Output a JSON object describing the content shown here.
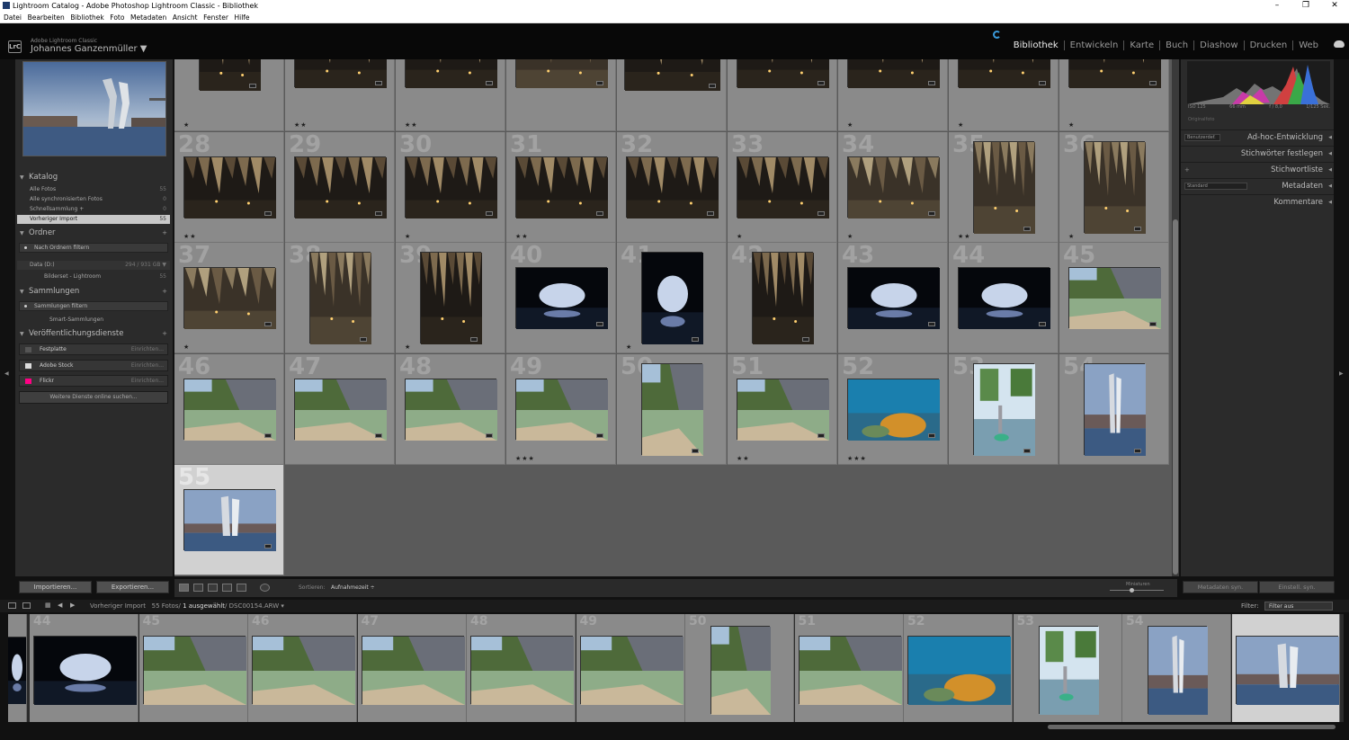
{
  "window": {
    "title": "Lightroom Catalog - Adobe Photoshop Lightroom Classic - Bibliothek",
    "controls": [
      "–",
      "❐",
      "✕"
    ]
  },
  "menu": [
    "Datei",
    "Bearbeiten",
    "Bibliothek",
    "Foto",
    "Metadaten",
    "Ansicht",
    "Fenster",
    "Hilfe"
  ],
  "identity": {
    "badge": "LrC",
    "product": "Adobe Lightroom Classic",
    "user": "Johannes Ganzenmüller ▼"
  },
  "modules": [
    {
      "label": "Bibliothek",
      "active": true
    },
    {
      "label": "Entwickeln",
      "active": false
    },
    {
      "label": "Karte",
      "active": false
    },
    {
      "label": "Buch",
      "active": false
    },
    {
      "label": "Diashow",
      "active": false
    },
    {
      "label": "Drucken",
      "active": false
    },
    {
      "label": "Web",
      "active": false
    }
  ],
  "left_panel": {
    "katalog": {
      "title": "Katalog",
      "items": [
        {
          "label": "Alle Fotos",
          "count": "55"
        },
        {
          "label": "Alle synchronisierten Fotos",
          "count": "0"
        },
        {
          "label": "Schnellsammlung +",
          "count": "0"
        },
        {
          "label": "Vorheriger Import",
          "count": "55",
          "selected": true
        }
      ]
    },
    "ordner": {
      "title": "Ordner",
      "filter": "Nach Ordnern filtern",
      "volume": {
        "label": "Data (D:)",
        "info": "294 / 931 GB ▼"
      },
      "folder": {
        "label": "Bilderset - Lightroom",
        "count": "55"
      }
    },
    "sammlungen": {
      "title": "Sammlungen",
      "filter": "Sammlungen filtern",
      "smart": "Smart-Sammlungen"
    },
    "dienste": {
      "title": "Veröffentlichungsdienste",
      "services": [
        {
          "label": "Festplatte",
          "setup": "Einrichten...",
          "color": "#555555"
        },
        {
          "label": "Adobe Stock",
          "setup": "Einrichten...",
          "color": "#1a1a1a"
        },
        {
          "label": "Flickr",
          "setup": "Einrichten...",
          "color": "#ff0084"
        }
      ],
      "more": "Weitere Dienste online suchen..."
    },
    "import_btn": "Importieren...",
    "export_btn": "Exportieren..."
  },
  "grid": {
    "cells": [
      {
        "num": "",
        "stars": "★",
        "kind": "cave",
        "shape": "portrait-s"
      },
      {
        "num": "",
        "stars": "★★",
        "kind": "cave",
        "shape": "land"
      },
      {
        "num": "",
        "stars": "★★",
        "kind": "cave",
        "shape": "land"
      },
      {
        "num": "",
        "stars": "",
        "kind": "cave-light",
        "shape": "land"
      },
      {
        "num": "",
        "stars": "",
        "kind": "cave",
        "shape": "land-t"
      },
      {
        "num": "",
        "stars": "",
        "kind": "cave",
        "shape": "land"
      },
      {
        "num": "",
        "stars": "★",
        "kind": "cave",
        "shape": "land"
      },
      {
        "num": "",
        "stars": "★",
        "kind": "cave",
        "shape": "land"
      },
      {
        "num": "",
        "stars": "★",
        "kind": "cave",
        "shape": "land"
      },
      {
        "num": "28",
        "stars": "★★",
        "kind": "cave",
        "shape": "land"
      },
      {
        "num": "29",
        "stars": "",
        "kind": "cave",
        "shape": "land"
      },
      {
        "num": "30",
        "stars": "★",
        "kind": "cave",
        "shape": "land"
      },
      {
        "num": "31",
        "stars": "★★",
        "kind": "cave",
        "shape": "land"
      },
      {
        "num": "32",
        "stars": "",
        "kind": "cave",
        "shape": "land"
      },
      {
        "num": "33",
        "stars": "★",
        "kind": "cave",
        "shape": "land"
      },
      {
        "num": "34",
        "stars": "★",
        "kind": "cave-light",
        "shape": "land"
      },
      {
        "num": "35",
        "stars": "★★",
        "kind": "cave-light",
        "shape": "portrait"
      },
      {
        "num": "36",
        "stars": "★",
        "kind": "cave-light",
        "shape": "portrait"
      },
      {
        "num": "37",
        "stars": "★",
        "kind": "cave-light",
        "shape": "land"
      },
      {
        "num": "38",
        "stars": "",
        "kind": "cave-light",
        "shape": "portrait"
      },
      {
        "num": "39",
        "stars": "★",
        "kind": "cave",
        "shape": "portrait"
      },
      {
        "num": "40",
        "stars": "",
        "kind": "arch",
        "shape": "land"
      },
      {
        "num": "41",
        "stars": "★",
        "kind": "arch",
        "shape": "portrait"
      },
      {
        "num": "42",
        "stars": "",
        "kind": "cave",
        "shape": "portrait"
      },
      {
        "num": "43",
        "stars": "",
        "kind": "arch",
        "shape": "land"
      },
      {
        "num": "44",
        "stars": "",
        "kind": "arch",
        "shape": "land"
      },
      {
        "num": "45",
        "stars": "",
        "kind": "river",
        "shape": "land"
      },
      {
        "num": "46",
        "stars": "",
        "kind": "river",
        "shape": "land"
      },
      {
        "num": "47",
        "stars": "",
        "kind": "river",
        "shape": "land"
      },
      {
        "num": "48",
        "stars": "",
        "kind": "river",
        "shape": "land"
      },
      {
        "num": "49",
        "stars": "★★★",
        "kind": "river",
        "shape": "land"
      },
      {
        "num": "50",
        "stars": "",
        "kind": "river",
        "shape": "portrait"
      },
      {
        "num": "51",
        "stars": "★★",
        "kind": "river",
        "shape": "land"
      },
      {
        "num": "52",
        "stars": "★★★",
        "kind": "reef",
        "shape": "land"
      },
      {
        "num": "53",
        "stars": "",
        "kind": "lake",
        "shape": "portrait"
      },
      {
        "num": "54",
        "stars": "",
        "kind": "statue",
        "shape": "portrait"
      },
      {
        "num": "55",
        "stars": "",
        "kind": "statue",
        "shape": "land",
        "selected": true
      }
    ]
  },
  "toolbar": {
    "sort_label": "Sortieren:",
    "sort_value": "Aufnahmezeit ÷",
    "thumb_label": "Miniaturen"
  },
  "right_panel": {
    "histogram": {
      "iso": "ISO 125",
      "focal": "66 mm",
      "aperture": "f / 8,0",
      "shutter": "1/125 Sek."
    },
    "original_photo": "Originalfoto",
    "sections": [
      {
        "label": "Ad-hoc-Entwicklung",
        "select": "Benutzerdef."
      },
      {
        "label": "Stichwörter festlegen",
        "select": ""
      },
      {
        "label": "Stichwortliste",
        "select": ""
      },
      {
        "label": "Metadaten",
        "select": "Standard"
      },
      {
        "label": "Kommentare",
        "select": ""
      }
    ],
    "sync_meta": "Metadaten syn.",
    "sync_settings": "Einstell. syn."
  },
  "filmstrip": {
    "source": "Vorheriger Import",
    "count": "55 Fotos/",
    "selected": "1 ausgewählt",
    "file": "/ DSC00154.ARW ▾",
    "filter_label": "Filter:",
    "filter_value": "Filter aus",
    "cells": [
      {
        "num": "44",
        "kind": "arch"
      },
      {
        "num": "45",
        "kind": "river"
      },
      {
        "num": "46",
        "kind": "river"
      },
      {
        "num": "47",
        "kind": "river"
      },
      {
        "num": "48",
        "kind": "river"
      },
      {
        "num": "49",
        "kind": "river"
      },
      {
        "num": "50",
        "kind": "river"
      },
      {
        "num": "51",
        "kind": "river"
      },
      {
        "num": "52",
        "kind": "reef"
      },
      {
        "num": "53",
        "kind": "lake"
      },
      {
        "num": "54",
        "kind": "statue"
      },
      {
        "num": "",
        "kind": "statue",
        "selected": true
      }
    ]
  }
}
